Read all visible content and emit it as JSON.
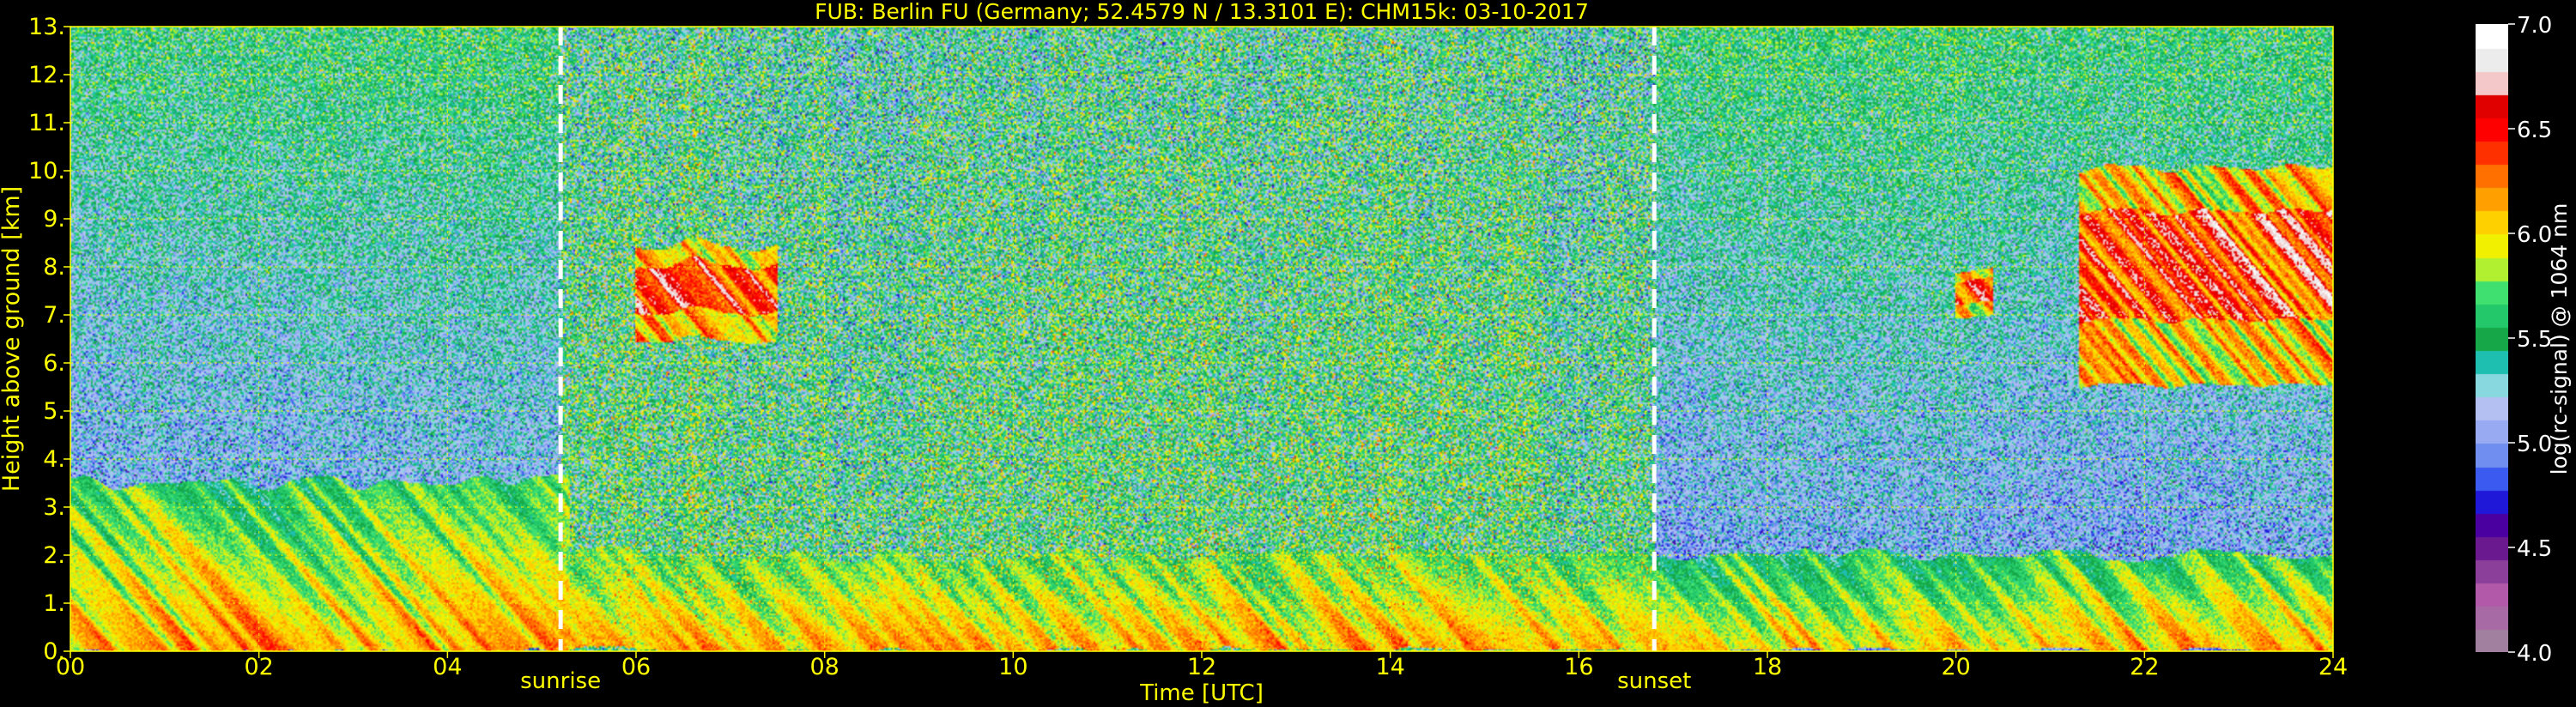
{
  "chart_data": {
    "type": "heatmap",
    "title": "FUB: Berlin FU (Germany; 52.4579 N / 13.3101 E):    CHM15k: 03-10-2017",
    "xlabel": "Time [UTC]",
    "ylabel": "Height above ground [km]",
    "xlim": [
      0,
      24
    ],
    "ylim": [
      0,
      13
    ],
    "x_ticks": [
      "00",
      "02",
      "04",
      "06",
      "08",
      "10",
      "12",
      "14",
      "16",
      "18",
      "20",
      "22",
      "24"
    ],
    "y_ticks": [
      "0.",
      "1.",
      "2.",
      "3.",
      "4.",
      "5.",
      "6.",
      "7.",
      "8.",
      "9.",
      "10.",
      "11.",
      "12.",
      "13."
    ],
    "grid": true,
    "grid_color": "#ffff00",
    "text_color": "#ffff00",
    "markers": [
      {
        "label": "sunrise",
        "time_h": 5.2
      },
      {
        "label": "sunset",
        "time_h": 16.8
      }
    ],
    "colorbar": {
      "label": "log(rc-signal) @ 1064 nm",
      "range": [
        4.0,
        7.0
      ],
      "ticks": [
        "4.0",
        "4.5",
        "5.0",
        "5.5",
        "6.0",
        "6.5",
        "7.0"
      ],
      "colors": [
        "#a07f9f",
        "#a86aa5",
        "#b25aa9",
        "#8c3f9a",
        "#6a1a8e",
        "#4a00a0",
        "#2018d8",
        "#3a5af0",
        "#6f8ef0",
        "#98aaf2",
        "#b4c0f2",
        "#88d8e0",
        "#1ebfb0",
        "#16a848",
        "#22c86a",
        "#40e070",
        "#b0f030",
        "#f0f000",
        "#ffd000",
        "#ffa000",
        "#ff7000",
        "#ff3000",
        "#ff0000",
        "#e00000",
        "#f4c8c8",
        "#ececec",
        "#ffffff"
      ]
    },
    "features": [
      {
        "name": "boundary layer aerosol",
        "t_start": 0,
        "t_end": 24,
        "top_km": 2.0
      },
      {
        "name": "residual layer",
        "t_start": 0,
        "t_end": 5.3,
        "top_km": 3.5
      },
      {
        "name": "cloud",
        "t_start": 6.0,
        "t_end": 7.5,
        "base_km": 6.5,
        "top_km": 8.5
      },
      {
        "name": "cirrus",
        "t_start": 21.3,
        "t_end": 24,
        "base_km": 5.5,
        "top_km": 10.0
      },
      {
        "name": "cloud",
        "t_start": 20.0,
        "t_end": 20.4,
        "base_km": 7.0,
        "top_km": 8.0
      }
    ]
  }
}
